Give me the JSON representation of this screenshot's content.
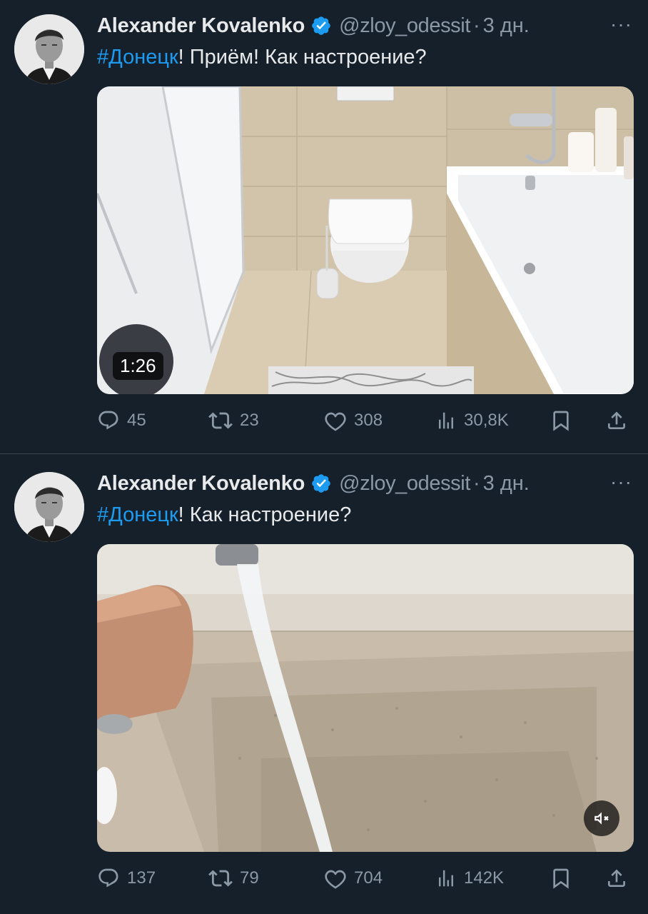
{
  "colors": {
    "background": "#15202b",
    "accent": "#1d9bf0",
    "muted": "#8b98a5",
    "text": "#e7e9ea"
  },
  "tweets": [
    {
      "author_name": "Alexander Kovalenko",
      "handle": "@zloy_odessit",
      "separator": "·",
      "time": "3 дн.",
      "more": "···",
      "hashtag": "#Донецк",
      "text_rest": "! Приём! Как настроение?",
      "video_duration": "1:26",
      "replies": "45",
      "retweets": "23",
      "likes": "308",
      "views": "30,8K"
    },
    {
      "author_name": "Alexander Kovalenko",
      "handle": "@zloy_odessit",
      "separator": "·",
      "time": "3 дн.",
      "more": "···",
      "hashtag": "#Донецк",
      "text_rest": "! Как настроение?",
      "replies": "137",
      "retweets": "79",
      "likes": "704",
      "views": "142K"
    }
  ],
  "icons": [
    "avatar",
    "verified-badge-icon",
    "more-icon",
    "reply-icon",
    "retweet-icon",
    "like-icon",
    "views-icon",
    "bookmark-icon",
    "share-icon",
    "mute-icon"
  ]
}
